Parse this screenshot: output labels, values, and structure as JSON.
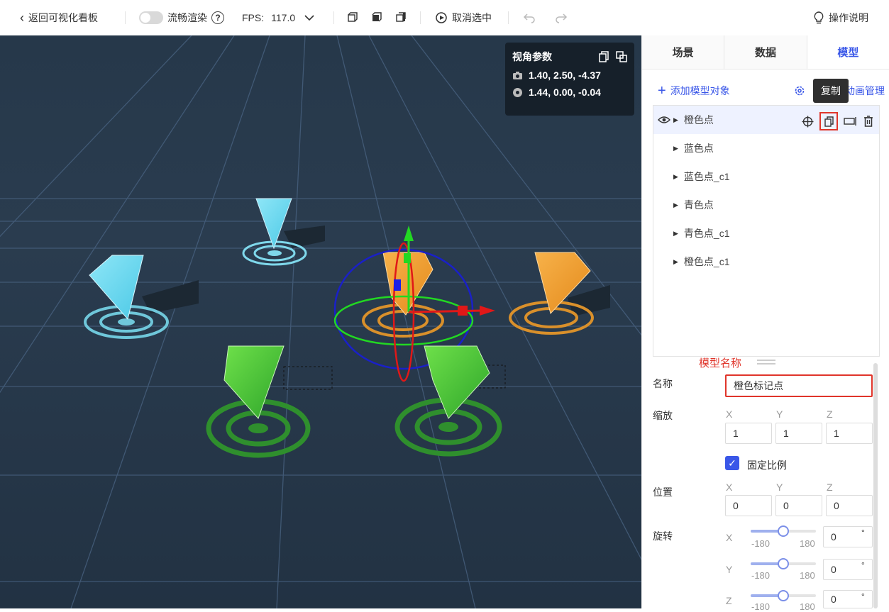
{
  "toolbar": {
    "back_label": "返回可视化看板",
    "smooth_label": "流畅渲染",
    "fps_label": "FPS:",
    "fps_value": "117.0",
    "deselect_label": "取消选中",
    "help_label": "操作说明"
  },
  "view_params": {
    "title": "视角参数",
    "camera": "1.40, 2.50, -4.37",
    "target": "1.44, 0.00, -0.04"
  },
  "tabs": [
    "场景",
    "数据",
    "模型"
  ],
  "active_tab": "模型",
  "panel": {
    "add_label": "添加模型对象",
    "anim_label": "动画管理",
    "tooltip": "复制"
  },
  "tree": [
    {
      "label": "橙色点"
    },
    {
      "label": "蓝色点"
    },
    {
      "label": "蓝色点_c1"
    },
    {
      "label": "青色点"
    },
    {
      "label": "青色点_c1"
    },
    {
      "label": "橙色点_c1"
    }
  ],
  "props": {
    "annotation": "模型名称",
    "name_label": "名称",
    "name_value": "橙色标记点",
    "scale_label": "缩放",
    "scale": {
      "x": "1",
      "y": "1",
      "z": "1"
    },
    "lock_ratio_label": "固定比例",
    "position_label": "位置",
    "position": {
      "x": "0",
      "y": "0",
      "z": "0"
    },
    "rotation_label": "旋转",
    "rotation": {
      "x": "0",
      "y": "0",
      "z": "0"
    },
    "slider_min": "-180",
    "slider_max": "180",
    "axis_x": "X",
    "axis_y": "Y",
    "axis_z": "Z",
    "degree": "°"
  },
  "colors": {
    "accent": "#3a57e8",
    "annotation_red": "#e0352b",
    "scene_bg": "#26384a"
  }
}
